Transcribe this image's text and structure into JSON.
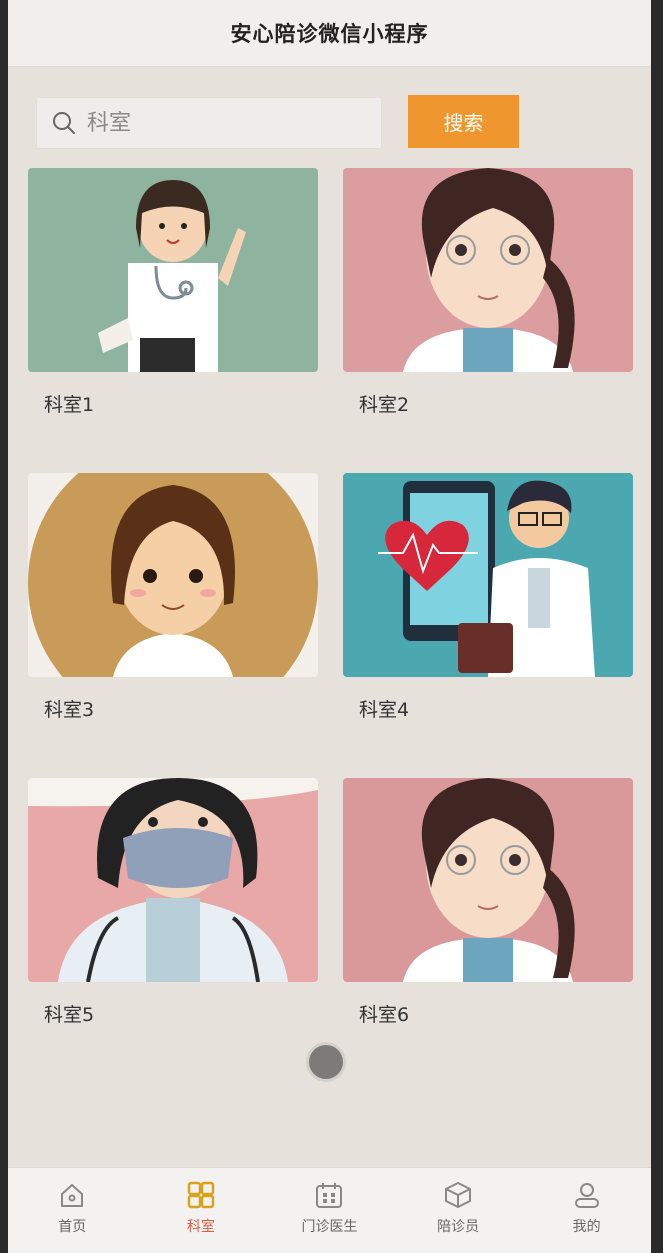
{
  "header": {
    "title": "安心陪诊微信小程序"
  },
  "search": {
    "placeholder": "科室",
    "button_label": "搜索"
  },
  "departments": [
    {
      "label": "科室1"
    },
    {
      "label": "科室2"
    },
    {
      "label": "科室3"
    },
    {
      "label": "科室4"
    },
    {
      "label": "科室5"
    },
    {
      "label": "科室6"
    }
  ],
  "tabs": [
    {
      "label": "首页",
      "icon": "home-icon",
      "active": false
    },
    {
      "label": "科室",
      "icon": "grid-icon",
      "active": true
    },
    {
      "label": "门诊医生",
      "icon": "calendar-icon",
      "active": false
    },
    {
      "label": "陪诊员",
      "icon": "box-icon",
      "active": false
    },
    {
      "label": "我的",
      "icon": "user-icon",
      "active": false
    }
  ],
  "colors": {
    "accent": "#f0962f",
    "active_tab": "#e15a45"
  }
}
